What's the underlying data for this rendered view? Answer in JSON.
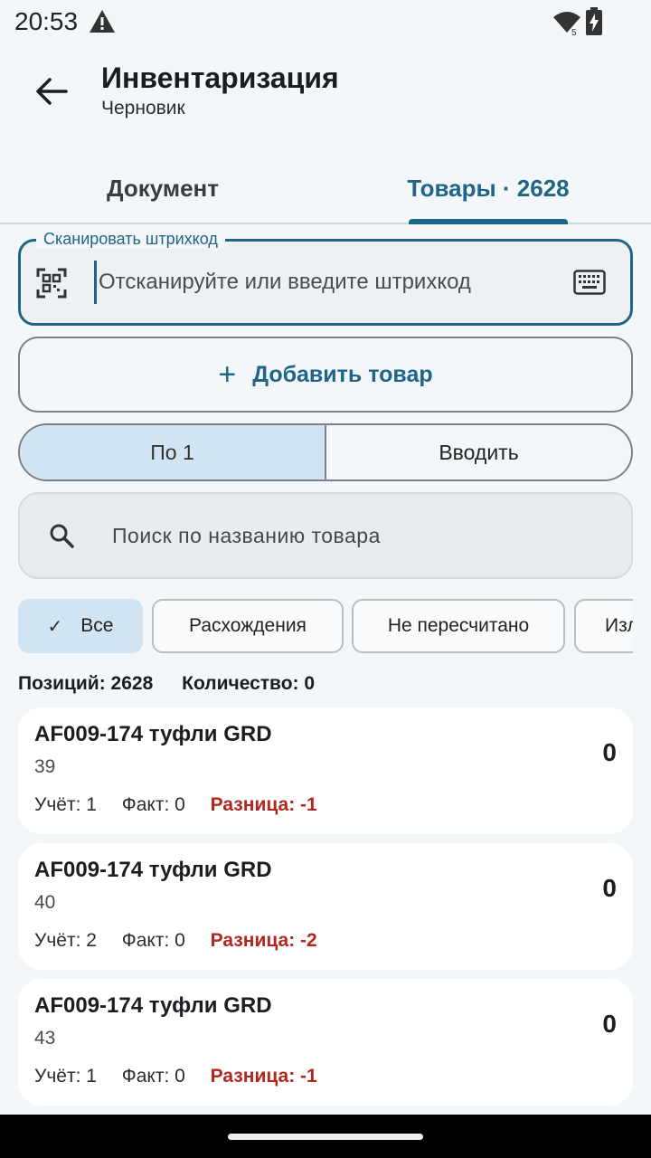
{
  "status_bar": {
    "time": "20:53",
    "sim_label": "5"
  },
  "app_bar": {
    "title": "Инвентаризация",
    "subtitle": "Черновик"
  },
  "tabs": [
    {
      "label": "Документ",
      "selected": false
    },
    {
      "label": "Товары · 2628",
      "selected": true
    }
  ],
  "scan": {
    "label": "Сканировать штрихкод",
    "placeholder": "Отсканируйте или введите штрихкод",
    "value": ""
  },
  "add_button": {
    "label": "Добавить товар"
  },
  "mode": {
    "options": [
      "По 1",
      "Вводить"
    ],
    "selected": "По 1"
  },
  "search": {
    "placeholder": "Поиск по названию товара",
    "value": ""
  },
  "filters": [
    {
      "label": "Все",
      "selected": true
    },
    {
      "label": "Расхождения",
      "selected": false
    },
    {
      "label": "Не пересчитано",
      "selected": false
    },
    {
      "label": "Изл",
      "selected": false
    }
  ],
  "summary": {
    "positions": "Позиций: 2628",
    "quantity": "Количество: 0"
  },
  "items": [
    {
      "name": "AF009-174 туфли GRD",
      "size": "39",
      "account": "Учёт: 1",
      "fact": "Факт: 0",
      "difference": "Разница: -1",
      "qty": "0"
    },
    {
      "name": "AF009-174 туфли GRD",
      "size": "40",
      "account": "Учёт: 2",
      "fact": "Факт: 0",
      "difference": "Разница: -2",
      "qty": "0"
    },
    {
      "name": "AF009-174 туфли GRD",
      "size": "43",
      "account": "Учёт: 1",
      "fact": "Факт: 0",
      "difference": "Разница: -1",
      "qty": "0"
    }
  ],
  "colors": {
    "accent": "#1e6587",
    "selected_bg": "#d1e4f4",
    "difference": "#b3261e",
    "background": "#f4f7fa"
  }
}
